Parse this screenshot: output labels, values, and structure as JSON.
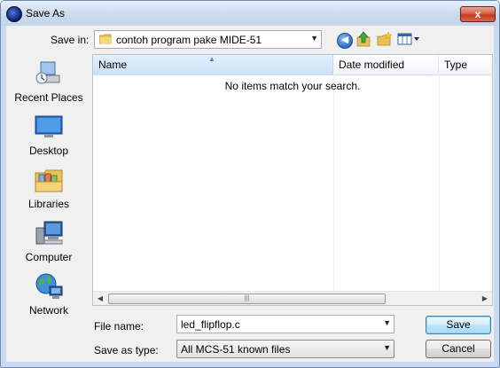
{
  "window": {
    "title": "Save As",
    "close_label": "x"
  },
  "toolbar": {
    "save_in_label": "Save in:",
    "save_in_value": "contoh program pake MIDE-51"
  },
  "places": [
    {
      "label": "Recent Places"
    },
    {
      "label": "Desktop"
    },
    {
      "label": "Libraries"
    },
    {
      "label": "Computer"
    },
    {
      "label": "Network"
    }
  ],
  "filelist": {
    "columns": {
      "name": "Name",
      "date": "Date modified",
      "type": "Type"
    },
    "empty_message": "No items match your search."
  },
  "form": {
    "file_name_label": "File name:",
    "file_name_value": "led_flipflop.c",
    "save_as_type_label": "Save as type:",
    "save_as_type_value": "All MCS-51 known files",
    "save_label": "Save",
    "cancel_label": "Cancel"
  },
  "colors": {
    "title_gradient": "#cddcee",
    "close_red": "#c23b1e",
    "list_border": "#b8c3d2",
    "header_selected": "#cbe1f8"
  },
  "icons": {
    "app": "app-icon",
    "back": "back-arrow-icon",
    "up": "up-folder-icon",
    "new_folder": "new-folder-icon",
    "views": "views-menu-icon"
  }
}
